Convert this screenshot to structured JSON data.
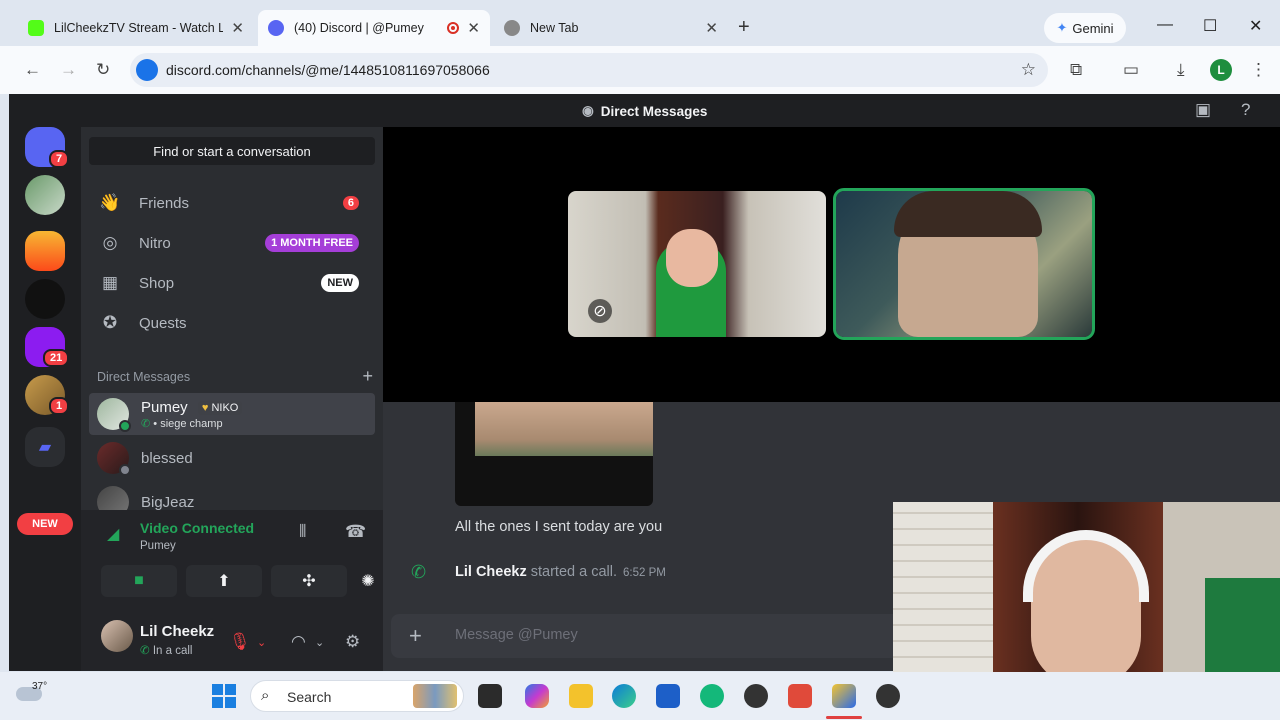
{
  "browser": {
    "tabs": [
      {
        "title": "LilCheekzTV Stream - Watch Liv",
        "active": false
      },
      {
        "title": "(40) Discord | @Pumey",
        "active": true
      },
      {
        "title": "New Tab",
        "active": false
      }
    ],
    "new_tab_label": "+",
    "gemini_label": "Gemini",
    "url": "discord.com/channels/@me/1448510811697058066",
    "profile_initial": "L"
  },
  "discord": {
    "header_title": "Direct Messages",
    "guild_badges": {
      "home": "7",
      "g5": "21",
      "g6": "1"
    },
    "new_pill": "NEW",
    "find_label": "Find or start a conversation",
    "nav": [
      {
        "label": "Friends",
        "badge": "6"
      },
      {
        "label": "Nitro",
        "badge": "1 MONTH FREE"
      },
      {
        "label": "Shop",
        "badge": "NEW"
      },
      {
        "label": "Quests",
        "badge": ""
      }
    ],
    "dm_header": "Direct Messages",
    "dms": [
      {
        "name": "Pumey",
        "tag": "NIKO",
        "sub": "• siege champ"
      },
      {
        "name": "blessed"
      },
      {
        "name": "BigJeaz"
      }
    ],
    "voice": {
      "title": "Video Connected",
      "sub": "Pumey"
    },
    "user": {
      "name": "Lil Cheekz",
      "status": "In a call"
    },
    "chat": {
      "message": "All the ones I sent today are you",
      "call_user": "Lil Cheekz",
      "call_text": "started a call.",
      "call_time": "6:52 PM",
      "composer_placeholder": "Message @Pumey"
    }
  },
  "taskbar": {
    "weather": "37°",
    "search_label": "Search"
  },
  "colors": {
    "discord_green": "#23a55a",
    "discord_red": "#f23f43",
    "nitro_purple": "#a53ed8"
  }
}
